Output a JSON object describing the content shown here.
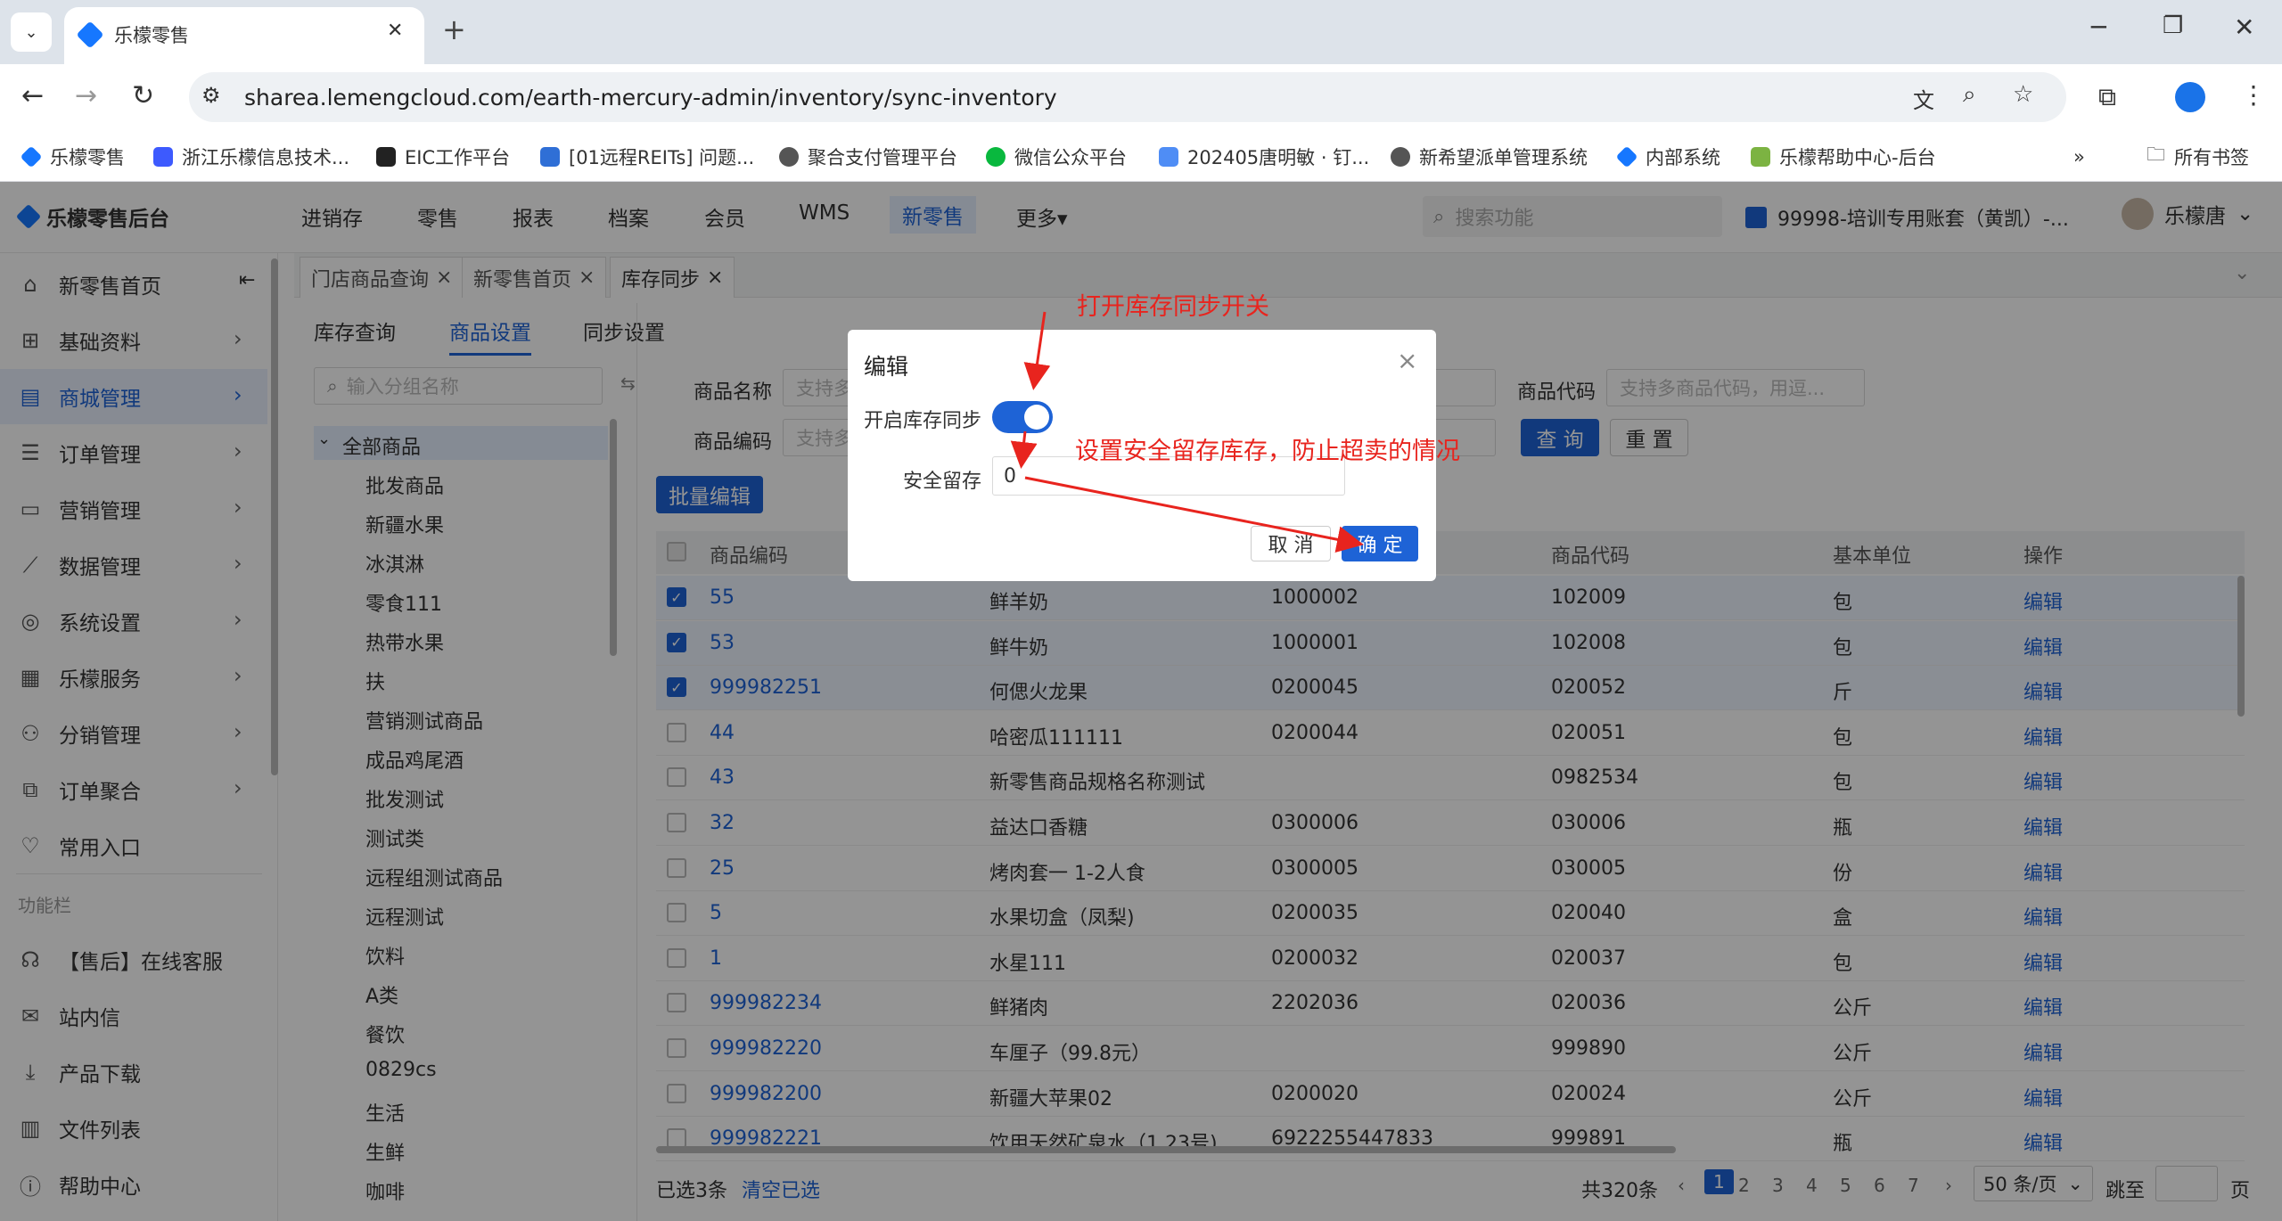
{
  "browser": {
    "tab_title": "乐檬零售",
    "url": "sharea.lemengcloud.com/earth-mercury-admin/inventory/sync-inventory",
    "bookmarks": [
      "乐檬零售",
      "浙江乐檬信息技术...",
      "EIC工作平台",
      "[01远程REITs] 问题...",
      "聚合支付管理平台",
      "微信公众平台",
      "202405唐明敏 · 钉...",
      "新希望派单管理系统",
      "内部系统",
      "乐檬帮助中心-后台"
    ],
    "bookmarks_more": "»",
    "all_bookmarks": "所有书签",
    "colors": {
      "tabstrip": "#dde3ea"
    }
  },
  "app": {
    "logo": "乐檬零售后台",
    "nav": [
      "进销存",
      "零售",
      "报表",
      "档案",
      "会员",
      "WMS",
      "新零售",
      "更多▾"
    ],
    "search_placeholder": "搜索功能",
    "account": "99998-培训专用账套（黄凯）-...",
    "user": "乐檬唐",
    "accent": "#1e63d6"
  },
  "sidebar": {
    "items": [
      "新零售首页",
      "基础资料",
      "商城管理",
      "订单管理",
      "营销管理",
      "数据管理",
      "系统设置",
      "乐檬服务",
      "分销管理",
      "订单聚合",
      "常用入口"
    ],
    "section": "功能栏",
    "func_items": [
      "【售后】在线客服",
      "站内信",
      "产品下载",
      "文件列表",
      "帮助中心"
    ]
  },
  "page_tabs": [
    "门店商品查询",
    "新零售首页",
    "库存同步"
  ],
  "sub_tabs": [
    "库存查询",
    "商品设置",
    "同步设置"
  ],
  "tree": {
    "search_placeholder": "输入分组名称",
    "root": "全部商品",
    "nodes": [
      "批发商品",
      "新疆水果",
      "冰淇淋",
      "零食111",
      "热带水果",
      "扶",
      "营销测试商品",
      "成品鸡尾酒",
      "批发测试",
      "测试类",
      "远程组测试商品",
      "远程测试",
      "饮料",
      "A类",
      "餐饮",
      "0829cs",
      "生活",
      "生鲜",
      "咖啡"
    ]
  },
  "filters": {
    "name_label": "商品名称",
    "name_placeholder": "支持多",
    "code_label": "商品编码",
    "code_placeholder": "支持多",
    "item_code_label": "商品代码",
    "item_code_placeholder": "支持多商品代码，用逗...",
    "query": "查 询",
    "reset": "重 置",
    "batch_edit": "批量编辑"
  },
  "table": {
    "headers": [
      "商品编码",
      "商品代码",
      "基本单位",
      "操作"
    ],
    "rows": [
      {
        "code": "55",
        "name": "鲜羊奶",
        "barcode": "1000002",
        "item_code": "102009",
        "unit": "包",
        "checked": true
      },
      {
        "code": "53",
        "name": "鲜牛奶",
        "barcode": "1000001",
        "item_code": "102008",
        "unit": "包",
        "checked": true
      },
      {
        "code": "999982251",
        "name": "何偲火龙果",
        "barcode": "0200045",
        "item_code": "020052",
        "unit": "斤",
        "checked": true
      },
      {
        "code": "44",
        "name": "哈密瓜111111",
        "barcode": "0200044",
        "item_code": "020051",
        "unit": "包",
        "checked": false
      },
      {
        "code": "43",
        "name": "新零售商品规格名称测试",
        "barcode": "",
        "item_code": "0982534",
        "unit": "包",
        "checked": false
      },
      {
        "code": "32",
        "name": "益达口香糖",
        "barcode": "0300006",
        "item_code": "030006",
        "unit": "瓶",
        "checked": false
      },
      {
        "code": "25",
        "name": "烤肉套一 1-2人食",
        "barcode": "0300005",
        "item_code": "030005",
        "unit": "份",
        "checked": false
      },
      {
        "code": "5",
        "name": "水果切盒（凤梨)",
        "barcode": "0200035",
        "item_code": "020040",
        "unit": "盒",
        "checked": false
      },
      {
        "code": "1",
        "name": "水星111",
        "barcode": "0200032",
        "item_code": "020037",
        "unit": "包",
        "checked": false
      },
      {
        "code": "999982234",
        "name": "鲜猪肉",
        "barcode": "2202036",
        "item_code": "020036",
        "unit": "公斤",
        "checked": false
      },
      {
        "code": "999982220",
        "name": "车厘子（99.8元）",
        "barcode": "",
        "item_code": "999890",
        "unit": "公斤",
        "checked": false
      },
      {
        "code": "999982200",
        "name": "新疆大苹果02",
        "barcode": "0200020",
        "item_code": "020024",
        "unit": "公斤",
        "checked": false
      },
      {
        "code": "999982221",
        "name": "饮用天然矿泉水（1.23号)",
        "barcode": "6922255447833",
        "item_code": "999891",
        "unit": "瓶",
        "checked": false
      }
    ],
    "action": "编辑"
  },
  "footer": {
    "selected": "已选3条",
    "clear": "清空已选",
    "total": "共320条",
    "pages": [
      "1",
      "2",
      "3",
      "4",
      "5",
      "6",
      "7"
    ],
    "page_size": "50 条/页",
    "goto": "跳至",
    "page_unit": "页"
  },
  "modal": {
    "title": "编辑",
    "sync_label": "开启库存同步",
    "sync_on": true,
    "safety_label": "安全留存",
    "safety_value": "0",
    "cancel": "取 消",
    "confirm": "确 定"
  },
  "annotations": {
    "a1": "打开库存同步开关",
    "a2": "设置安全留存库存，防止超卖的情况",
    "color": "#e8241e"
  }
}
